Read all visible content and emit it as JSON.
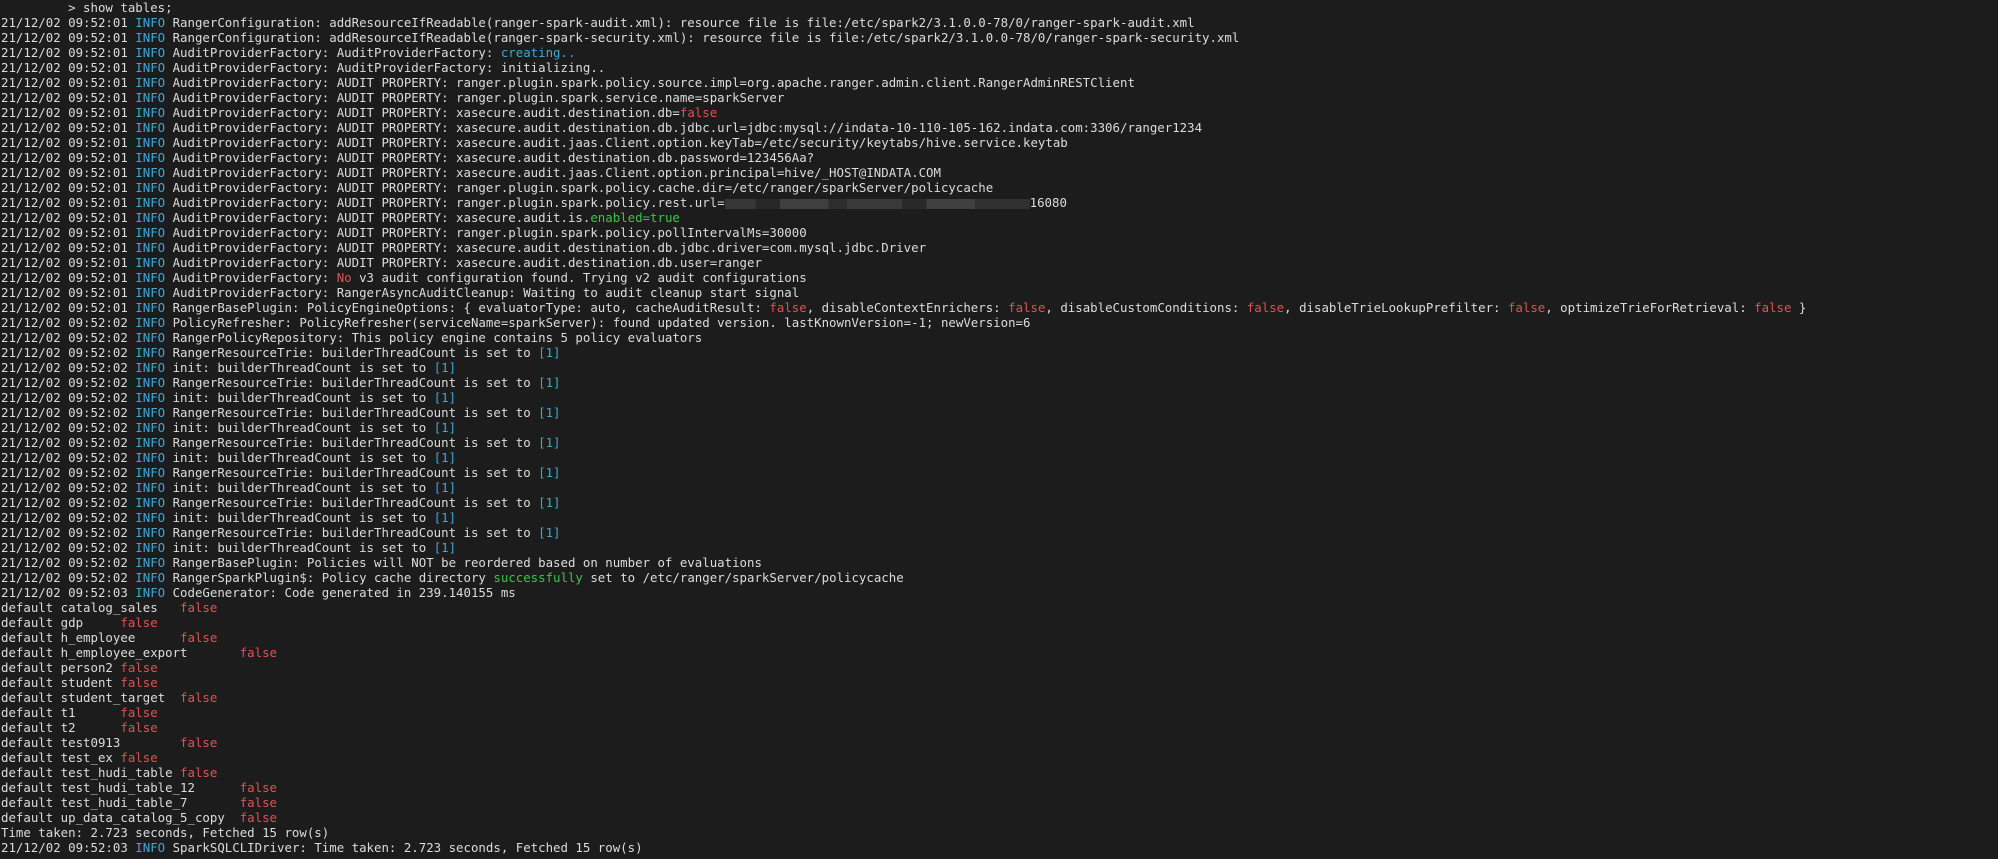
{
  "colors": {
    "background": "#1c1c1c",
    "text": "#dcdcdc",
    "info": "#3fa7d6",
    "false": "#e05252",
    "true": "#3cc34a",
    "bracket": "#3fa7d6"
  },
  "lines": [
    [
      {
        "t": "         > show tables;"
      }
    ],
    [
      {
        "t": "21/12/02 09:52:01 "
      },
      {
        "t": "INFO",
        "c": "info"
      },
      {
        "t": " RangerConfiguration: addResourceIfReadable(ranger-spark-audit.xml): resource file is file:/etc/spark2/3.1.0.0-78/0/ranger-spark-audit.xml"
      }
    ],
    [
      {
        "t": "21/12/02 09:52:01 "
      },
      {
        "t": "INFO",
        "c": "info"
      },
      {
        "t": " RangerConfiguration: addResourceIfReadable(ranger-spark-security.xml): resource file is file:/etc/spark2/3.1.0.0-78/0/ranger-spark-security.xml"
      }
    ],
    [
      {
        "t": "21/12/02 09:52:01 "
      },
      {
        "t": "INFO",
        "c": "info"
      },
      {
        "t": " AuditProviderFactory: AuditProviderFactory: "
      },
      {
        "t": "creating..",
        "c": "blue"
      }
    ],
    [
      {
        "t": "21/12/02 09:52:01 "
      },
      {
        "t": "INFO",
        "c": "info"
      },
      {
        "t": " AuditProviderFactory: AuditProviderFactory: initializing.."
      }
    ],
    [
      {
        "t": "21/12/02 09:52:01 "
      },
      {
        "t": "INFO",
        "c": "info"
      },
      {
        "t": " AuditProviderFactory: AUDIT PROPERTY: ranger.plugin.spark.policy.source.impl=org.apache.ranger.admin.client.RangerAdminRESTClient"
      }
    ],
    [
      {
        "t": "21/12/02 09:52:01 "
      },
      {
        "t": "INFO",
        "c": "info"
      },
      {
        "t": " AuditProviderFactory: AUDIT PROPERTY: ranger.plugin.spark.service.name=sparkServer"
      }
    ],
    [
      {
        "t": "21/12/02 09:52:01 "
      },
      {
        "t": "INFO",
        "c": "info"
      },
      {
        "t": " AuditProviderFactory: AUDIT PROPERTY: xasecure.audit.destination.db="
      },
      {
        "t": "false",
        "c": "red"
      }
    ],
    [
      {
        "t": "21/12/02 09:52:01 "
      },
      {
        "t": "INFO",
        "c": "info"
      },
      {
        "t": " AuditProviderFactory: AUDIT PROPERTY: xasecure.audit.destination.db.jdbc.url=jdbc:mysql://indata-10-110-105-162.indata.com:3306/ranger1234"
      }
    ],
    [
      {
        "t": "21/12/02 09:52:01 "
      },
      {
        "t": "INFO",
        "c": "info"
      },
      {
        "t": " AuditProviderFactory: AUDIT PROPERTY: xasecure.audit.jaas.Client.option.keyTab=/etc/security/keytabs/hive.service.keytab"
      }
    ],
    [
      {
        "t": "21/12/02 09:52:01 "
      },
      {
        "t": "INFO",
        "c": "info"
      },
      {
        "t": " AuditProviderFactory: AUDIT PROPERTY: xasecure.audit.destination.db.password=123456Aa?"
      }
    ],
    [
      {
        "t": "21/12/02 09:52:01 "
      },
      {
        "t": "INFO",
        "c": "info"
      },
      {
        "t": " AuditProviderFactory: AUDIT PROPERTY: xasecure.audit.jaas.Client.option.principal=hive/_HOST@INDATA.COM"
      }
    ],
    [
      {
        "t": "21/12/02 09:52:01 "
      },
      {
        "t": "INFO",
        "c": "info"
      },
      {
        "t": " AuditProviderFactory: AUDIT PROPERTY: ranger.plugin.spark.policy.cache.dir=/etc/ranger/sparkServer/policycache"
      }
    ],
    [
      {
        "t": "21/12/02 09:52:01 "
      },
      {
        "t": "INFO",
        "c": "info"
      },
      {
        "t": " AuditProviderFactory: AUDIT PROPERTY: ranger.plugin.spark.policy.rest.url="
      },
      {
        "redacted": true
      },
      {
        "t": "16080"
      }
    ],
    [
      {
        "t": "21/12/02 09:52:01 "
      },
      {
        "t": "INFO",
        "c": "info"
      },
      {
        "t": " AuditProviderFactory: AUDIT PROPERTY: xasecure.audit.is."
      },
      {
        "t": "enabled=true",
        "c": "green"
      }
    ],
    [
      {
        "t": "21/12/02 09:52:01 "
      },
      {
        "t": "INFO",
        "c": "info"
      },
      {
        "t": " AuditProviderFactory: AUDIT PROPERTY: ranger.plugin.spark.policy.pollIntervalMs=30000"
      }
    ],
    [
      {
        "t": "21/12/02 09:52:01 "
      },
      {
        "t": "INFO",
        "c": "info"
      },
      {
        "t": " AuditProviderFactory: AUDIT PROPERTY: xasecure.audit.destination.db.jdbc.driver=com.mysql.jdbc.Driver"
      }
    ],
    [
      {
        "t": "21/12/02 09:52:01 "
      },
      {
        "t": "INFO",
        "c": "info"
      },
      {
        "t": " AuditProviderFactory: AUDIT PROPERTY: xasecure.audit.destination.db.user=ranger"
      }
    ],
    [
      {
        "t": "21/12/02 09:52:01 "
      },
      {
        "t": "INFO",
        "c": "info"
      },
      {
        "t": " AuditProviderFactory: "
      },
      {
        "t": "No",
        "c": "red"
      },
      {
        "t": " v3 audit configuration found. Trying v2 audit configurations"
      }
    ],
    [
      {
        "t": "21/12/02 09:52:01 "
      },
      {
        "t": "INFO",
        "c": "info"
      },
      {
        "t": " AuditProviderFactory: RangerAsyncAuditCleanup: Waiting to audit cleanup start signal"
      }
    ],
    [
      {
        "t": "21/12/02 09:52:01 "
      },
      {
        "t": "INFO",
        "c": "info"
      },
      {
        "t": " RangerBasePlugin: PolicyEngineOptions: { evaluatorType: auto, cacheAuditResult: "
      },
      {
        "t": "false",
        "c": "red"
      },
      {
        "t": ", disableContextEnrichers: "
      },
      {
        "t": "false",
        "c": "red"
      },
      {
        "t": ", disableCustomConditions: "
      },
      {
        "t": "false",
        "c": "red"
      },
      {
        "t": ", disableTrieLookupPrefilter: "
      },
      {
        "t": "false",
        "c": "red"
      },
      {
        "t": ", optimizeTrieForRetrieval: "
      },
      {
        "t": "false",
        "c": "red"
      },
      {
        "t": " }"
      }
    ],
    [
      {
        "t": "21/12/02 09:52:02 "
      },
      {
        "t": "INFO",
        "c": "info"
      },
      {
        "t": " PolicyRefresher: PolicyRefresher(serviceName=sparkServer): found updated version. lastKnownVersion=-1; newVersion=6"
      }
    ],
    [
      {
        "t": "21/12/02 09:52:02 "
      },
      {
        "t": "INFO",
        "c": "info"
      },
      {
        "t": " RangerPolicyRepository: This policy engine contains 5 policy evaluators"
      }
    ],
    [
      {
        "t": "21/12/02 09:52:02 "
      },
      {
        "t": "INFO",
        "c": "info"
      },
      {
        "t": " RangerResourceTrie: builderThreadCount is set to "
      },
      {
        "t": "[1]",
        "c": "blue"
      }
    ],
    [
      {
        "t": "21/12/02 09:52:02 "
      },
      {
        "t": "INFO",
        "c": "info"
      },
      {
        "t": " init: builderThreadCount is set to "
      },
      {
        "t": "[1]",
        "c": "blue"
      }
    ],
    [
      {
        "t": "21/12/02 09:52:02 "
      },
      {
        "t": "INFO",
        "c": "info"
      },
      {
        "t": " RangerResourceTrie: builderThreadCount is set to "
      },
      {
        "t": "[1]",
        "c": "blue"
      }
    ],
    [
      {
        "t": "21/12/02 09:52:02 "
      },
      {
        "t": "INFO",
        "c": "info"
      },
      {
        "t": " init: builderThreadCount is set to "
      },
      {
        "t": "[1]",
        "c": "blue"
      }
    ],
    [
      {
        "t": "21/12/02 09:52:02 "
      },
      {
        "t": "INFO",
        "c": "info"
      },
      {
        "t": " RangerResourceTrie: builderThreadCount is set to "
      },
      {
        "t": "[1]",
        "c": "blue"
      }
    ],
    [
      {
        "t": "21/12/02 09:52:02 "
      },
      {
        "t": "INFO",
        "c": "info"
      },
      {
        "t": " init: builderThreadCount is set to "
      },
      {
        "t": "[1]",
        "c": "blue"
      }
    ],
    [
      {
        "t": "21/12/02 09:52:02 "
      },
      {
        "t": "INFO",
        "c": "info"
      },
      {
        "t": " RangerResourceTrie: builderThreadCount is set to "
      },
      {
        "t": "[1]",
        "c": "blue"
      }
    ],
    [
      {
        "t": "21/12/02 09:52:02 "
      },
      {
        "t": "INFO",
        "c": "info"
      },
      {
        "t": " init: builderThreadCount is set to "
      },
      {
        "t": "[1]",
        "c": "blue"
      }
    ],
    [
      {
        "t": "21/12/02 09:52:02 "
      },
      {
        "t": "INFO",
        "c": "info"
      },
      {
        "t": " RangerResourceTrie: builderThreadCount is set to "
      },
      {
        "t": "[1]",
        "c": "blue"
      }
    ],
    [
      {
        "t": "21/12/02 09:52:02 "
      },
      {
        "t": "INFO",
        "c": "info"
      },
      {
        "t": " init: builderThreadCount is set to "
      },
      {
        "t": "[1]",
        "c": "blue"
      }
    ],
    [
      {
        "t": "21/12/02 09:52:02 "
      },
      {
        "t": "INFO",
        "c": "info"
      },
      {
        "t": " RangerResourceTrie: builderThreadCount is set to "
      },
      {
        "t": "[1]",
        "c": "blue"
      }
    ],
    [
      {
        "t": "21/12/02 09:52:02 "
      },
      {
        "t": "INFO",
        "c": "info"
      },
      {
        "t": " init: builderThreadCount is set to "
      },
      {
        "t": "[1]",
        "c": "blue"
      }
    ],
    [
      {
        "t": "21/12/02 09:52:02 "
      },
      {
        "t": "INFO",
        "c": "info"
      },
      {
        "t": " RangerResourceTrie: builderThreadCount is set to "
      },
      {
        "t": "[1]",
        "c": "blue"
      }
    ],
    [
      {
        "t": "21/12/02 09:52:02 "
      },
      {
        "t": "INFO",
        "c": "info"
      },
      {
        "t": " init: builderThreadCount is set to "
      },
      {
        "t": "[1]",
        "c": "blue"
      }
    ],
    [
      {
        "t": "21/12/02 09:52:02 "
      },
      {
        "t": "INFO",
        "c": "info"
      },
      {
        "t": " RangerBasePlugin: Policies will NOT be reordered based on number of evaluations"
      }
    ],
    [
      {
        "t": "21/12/02 09:52:02 "
      },
      {
        "t": "INFO",
        "c": "info"
      },
      {
        "t": " RangerSparkPlugin$: Policy cache directory "
      },
      {
        "t": "successfully",
        "c": "green"
      },
      {
        "t": " set to /etc/ranger/sparkServer/policycache"
      }
    ],
    [
      {
        "t": "21/12/02 09:52:03 "
      },
      {
        "t": "INFO",
        "c": "info"
      },
      {
        "t": " CodeGenerator: Code generated in 239.140155 ms"
      }
    ],
    [
      {
        "t": "default catalog_sales   "
      },
      {
        "t": "false",
        "c": "red"
      }
    ],
    [
      {
        "t": "default gdp     "
      },
      {
        "t": "false",
        "c": "red"
      }
    ],
    [
      {
        "t": "default h_employee      "
      },
      {
        "t": "false",
        "c": "red"
      }
    ],
    [
      {
        "t": "default h_employee_export       "
      },
      {
        "t": "false",
        "c": "red"
      }
    ],
    [
      {
        "t": "default person2 "
      },
      {
        "t": "false",
        "c": "red"
      }
    ],
    [
      {
        "t": "default student "
      },
      {
        "t": "false",
        "c": "red"
      }
    ],
    [
      {
        "t": "default student_target  "
      },
      {
        "t": "false",
        "c": "red"
      }
    ],
    [
      {
        "t": "default t1      "
      },
      {
        "t": "false",
        "c": "red"
      }
    ],
    [
      {
        "t": "default t2      "
      },
      {
        "t": "false",
        "c": "red"
      }
    ],
    [
      {
        "t": "default test0913        "
      },
      {
        "t": "false",
        "c": "red"
      }
    ],
    [
      {
        "t": "default test_ex "
      },
      {
        "t": "false",
        "c": "red"
      }
    ],
    [
      {
        "t": "default test_hudi_table "
      },
      {
        "t": "false",
        "c": "red"
      }
    ],
    [
      {
        "t": "default test_hudi_table_12      "
      },
      {
        "t": "false",
        "c": "red"
      }
    ],
    [
      {
        "t": "default test_hudi_table_7       "
      },
      {
        "t": "false",
        "c": "red"
      }
    ],
    [
      {
        "t": "default up_data_catalog_5_copy  "
      },
      {
        "t": "false",
        "c": "red"
      }
    ],
    [
      {
        "t": "Time taken: 2.723 seconds, Fetched 15 row(s)"
      }
    ],
    [
      {
        "t": "21/12/02 09:52:03 "
      },
      {
        "t": "INFO",
        "c": "info"
      },
      {
        "t": " SparkSQLCLIDriver: Time taken: 2.723 seconds, Fetched 15 row(s)"
      }
    ]
  ]
}
